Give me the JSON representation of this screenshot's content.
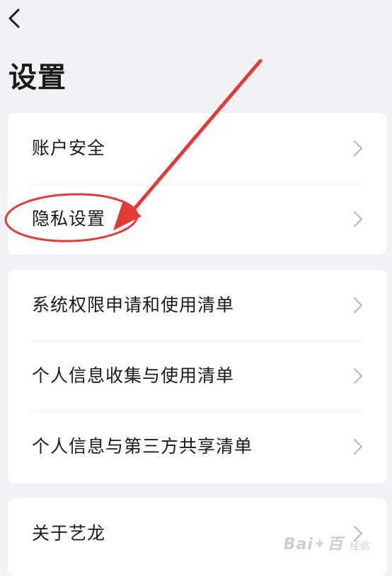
{
  "header": {
    "title": "设置"
  },
  "groups": [
    {
      "items": [
        {
          "label": "账户安全"
        },
        {
          "label": "隐私设置"
        }
      ]
    },
    {
      "items": [
        {
          "label": "系统权限申请和使用清单"
        },
        {
          "label": "个人信息收集与使用清单"
        },
        {
          "label": "个人信息与第三方共享清单"
        }
      ]
    },
    {
      "items": [
        {
          "label": "关于艺龙"
        }
      ]
    }
  ],
  "watermark": {
    "brand_left": "Bai",
    "brand_right": "百",
    "sub": "经验"
  },
  "icons": {
    "back": "chevron-left-icon",
    "row": "chevron-right-icon"
  },
  "colors": {
    "background": "#f2f2f4",
    "card": "#ffffff",
    "annotation": "#e53935"
  }
}
